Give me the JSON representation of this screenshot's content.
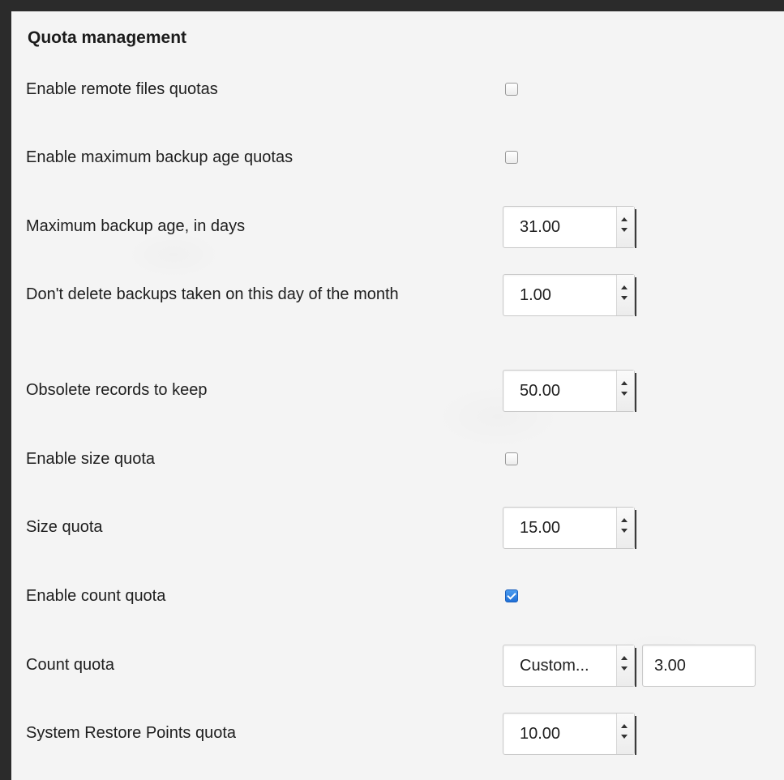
{
  "section": {
    "title": "Quota management"
  },
  "settings": {
    "remote_files_quotas": {
      "label": "Enable remote files quotas",
      "checked": false
    },
    "max_backup_age_quotas": {
      "label": "Enable maximum backup age quotas",
      "checked": false
    },
    "max_backup_age_days": {
      "label": "Maximum backup age, in days",
      "value": "31.00"
    },
    "dont_delete_day": {
      "label": "Don't delete backups taken on this day of the month",
      "value": "1.00"
    },
    "obsolete_records": {
      "label": "Obsolete records to keep",
      "value": "50.00"
    },
    "size_quota_enable": {
      "label": "Enable size quota",
      "checked": false
    },
    "size_quota": {
      "label": "Size quota",
      "value": "15.00"
    },
    "count_quota_enable": {
      "label": "Enable count quota",
      "checked": true
    },
    "count_quota": {
      "label": "Count quota",
      "select_value": "Custom...",
      "input_value": "3.00"
    },
    "system_restore_points": {
      "label": "System Restore Points quota",
      "value": "10.00"
    }
  },
  "colors": {
    "panel_background": "#f4f4f4",
    "frame_background": "#2b2b2b",
    "checkbox_checked": "#1f6fd6"
  }
}
